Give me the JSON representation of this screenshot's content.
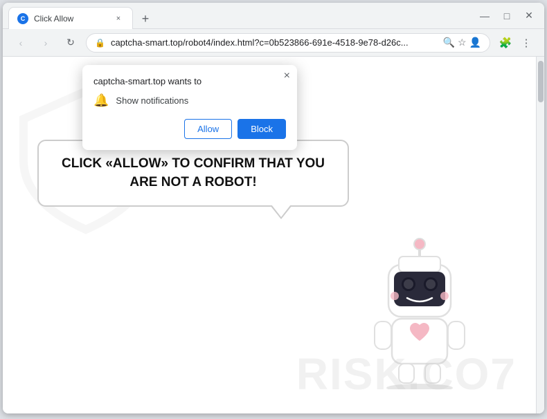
{
  "browser": {
    "title": "Click Allow",
    "tab": {
      "favicon_letter": "C",
      "title": "Click Allow",
      "close_label": "×"
    },
    "new_tab_label": "+",
    "window_controls": {
      "minimize": "—",
      "maximize": "□",
      "close": "✕"
    },
    "nav": {
      "back_label": "‹",
      "forward_label": "›",
      "refresh_label": "↻"
    },
    "url": {
      "lock_icon": "🔒",
      "address": "captcha-smart.top/robot4/index.html?c=0b523866-691e-4518-9e78-d26c...",
      "search_icon": "🔍",
      "star_icon": "☆",
      "profile_icon": "👤",
      "menu_icon": "⋮",
      "extensions_icon": "🧩"
    }
  },
  "notification_popup": {
    "site": "captcha-smart.top wants to",
    "close_label": "×",
    "bell_icon": "🔔",
    "notification_text": "Show notifications",
    "allow_label": "Allow",
    "block_label": "Block"
  },
  "page": {
    "speech_text_line1": "CLICK «ALLOW» TO CONFIRM THAT YOU",
    "speech_text_line2": "ARE NOT A ROBOT!",
    "watermark_text": "RISK.CO7"
  }
}
